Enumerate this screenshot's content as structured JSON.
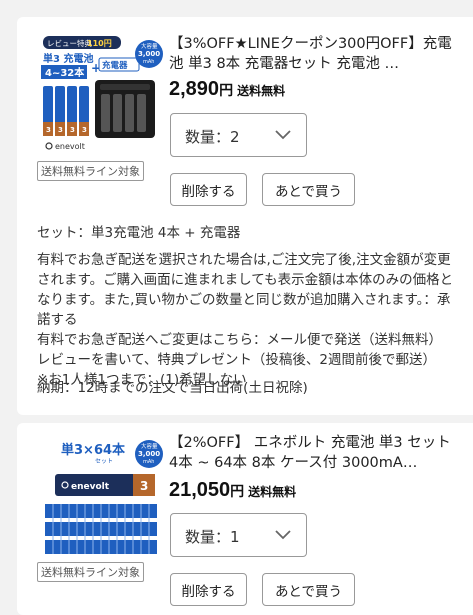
{
  "items": [
    {
      "title": "【3%OFF★LINEクーポン300円OFF】充電池 単3 8本 充電器セット 充電池 …",
      "price": "2,890",
      "yen": "円",
      "shipping_free": "送料無料",
      "quantity_label": "数量：2",
      "badge": "送料無料ライン対象",
      "delete_label": "削除する",
      "later_label": "あとで買う",
      "thumb": {
        "line1": "レビュー特典",
        "line1b": "110円",
        "line2": "単3 充電池",
        "line3": "4~32本",
        "plus": "+",
        "charger": "充電器",
        "cap": "大容量",
        "capval": "3,000",
        "capunit": "mAh",
        "brand": "enevolt"
      },
      "set_line": "セット：単3充電池 4本 + 充電器",
      "paragraph": "有料でお急ぎ配送を選択された場合は,ご注文完了後,注文金額が変更されます。ご購入画面に進まれましても表示金額は本体のみの価格となります。また,買い物かごの数量と同じ数が追加購入されます。：承諾する",
      "change_line": "有料でお急ぎ配送へご変更はこちら：メール便で発送（送料無料）",
      "review_line": "レビューを書いて、特典プレゼント（投稿後、2週間前後で郵送）",
      "limit_line": "※お1人様1つまで：(1)希望しない",
      "delivery_line": "納期：12時までの注文で当日出荷(土日祝除)"
    },
    {
      "title": "【2%OFF】 エネボルト 充電池 単3 セット4本 ~ 64本 8本 ケース付 3000mA…",
      "price": "21,050",
      "yen": "円",
      "shipping_free": "送料無料",
      "quantity_label": "数量：1",
      "badge": "送料無料ライン対象",
      "delete_label": "削除する",
      "later_label": "あとで買う",
      "thumb": {
        "headline": "単3×64本",
        "sub": "セット",
        "cap": "大容量",
        "capval": "3,000",
        "capunit": "mAh",
        "brand": "enevolt",
        "num": "3"
      }
    }
  ],
  "colors": {
    "accent_blue": "#1f5fbf",
    "navy": "#1c2f5a",
    "copper": "#b5672b"
  }
}
